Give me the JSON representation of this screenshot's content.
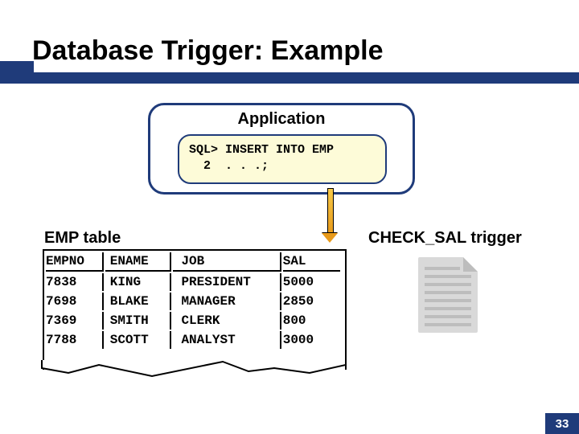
{
  "title": "Database Trigger: Example",
  "application": {
    "label": "Application",
    "sql_line1": "SQL> INSERT INTO EMP",
    "sql_line2": "  2  . . .;"
  },
  "emp_table_label": "EMP table",
  "check_sal_label": "CHECK_SAL trigger",
  "table": {
    "headers": {
      "empno": "EMPNO",
      "ename": "ENAME",
      "job": "JOB",
      "sal": "SAL"
    },
    "rows": [
      {
        "empno": "7838",
        "ename": "KING",
        "job": "PRESIDENT",
        "sal": "5000"
      },
      {
        "empno": "7698",
        "ename": "BLAKE",
        "job": "MANAGER",
        "sal": "2850"
      },
      {
        "empno": "7369",
        "ename": "SMITH",
        "job": "CLERK",
        "sal": "800"
      },
      {
        "empno": "7788",
        "ename": "SCOTT",
        "job": "ANALYST",
        "sal": "3000"
      }
    ]
  },
  "page_number": "33"
}
